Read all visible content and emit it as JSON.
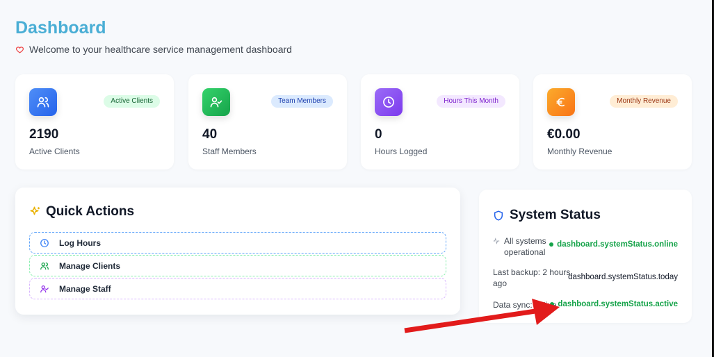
{
  "header": {
    "title": "Dashboard",
    "subtitle": "Welcome to your healthcare service management dashboard"
  },
  "stats": [
    {
      "badge": "Active Clients",
      "value": "2190",
      "label": "Active Clients",
      "icon": "users-icon",
      "color": "#3b82f6"
    },
    {
      "badge": "Team Members",
      "value": "40",
      "label": "Staff Members",
      "icon": "user-check-icon",
      "color": "#22c55e"
    },
    {
      "badge": "Hours This Month",
      "value": "0",
      "label": "Hours Logged",
      "icon": "clock-icon",
      "color": "#8b5cf6"
    },
    {
      "badge": "Monthly Revenue",
      "value": "€0.00",
      "label": "Monthly Revenue",
      "icon": "euro-icon",
      "color": "#f59e0b"
    }
  ],
  "quick_actions": {
    "title": "Quick Actions",
    "items": [
      {
        "label": "Log Hours",
        "icon": "clock-icon",
        "color": "#60a5fa"
      },
      {
        "label": "Manage Clients",
        "icon": "users-icon",
        "color": "#4ade80"
      },
      {
        "label": "Manage Staff",
        "icon": "user-check-icon",
        "color": "#c084fc"
      }
    ]
  },
  "system_status": {
    "title": "System Status",
    "rows": [
      {
        "label_line1": "All systems",
        "label_line2": "operational",
        "value": "dashboard.systemStatus.online"
      },
      {
        "label_line1": "Last backup: 2 hours",
        "label_line2": "ago",
        "value": "dashboard.systemStatus.today"
      },
      {
        "label_line1": "Data sync: active",
        "value": "dashboard.systemStatus.active"
      }
    ]
  },
  "colors": {
    "title": "#4aaed5",
    "status_green": "#16a34a",
    "annotation_arrow": "#e21b1b"
  }
}
